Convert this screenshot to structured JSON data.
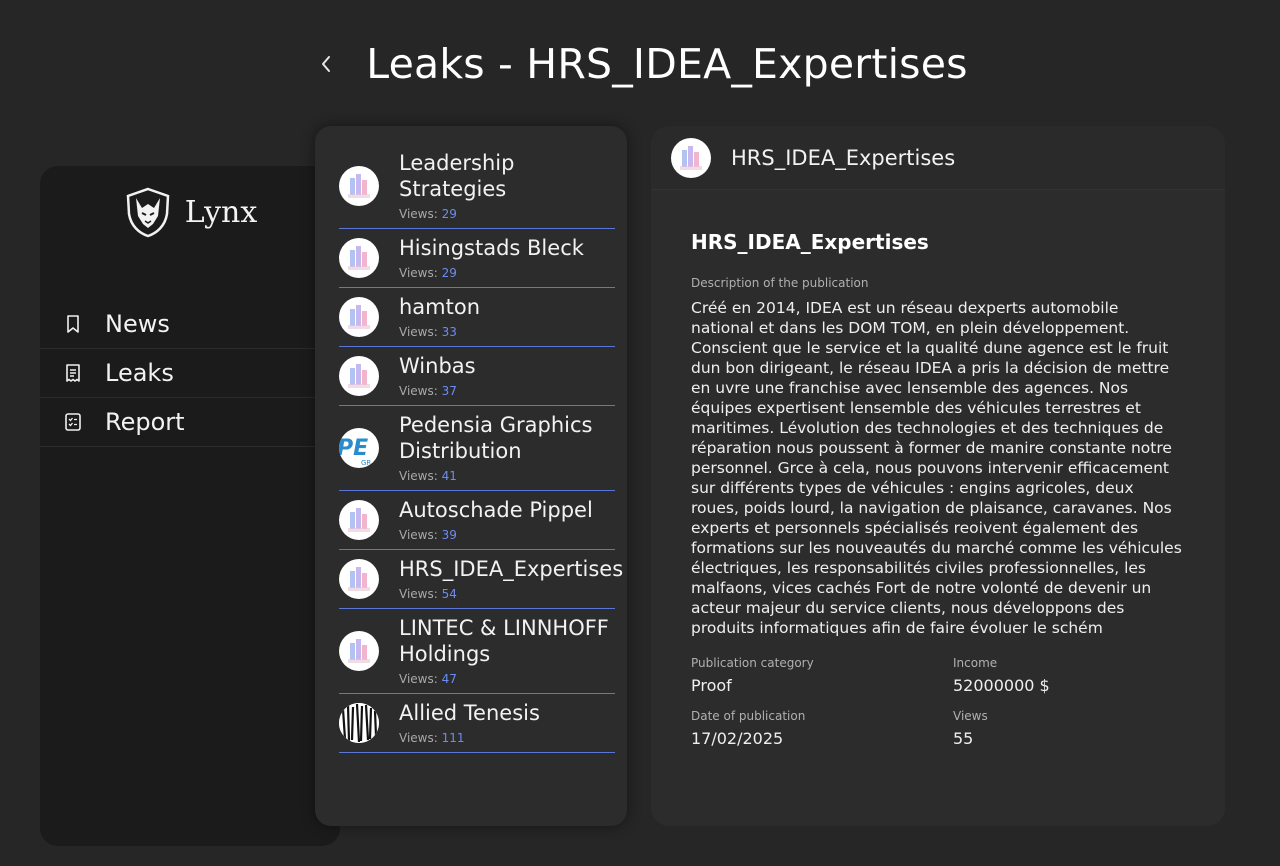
{
  "header": {
    "title": "Leaks - HRS_IDEA_Expertises"
  },
  "sidebar": {
    "brand": "Lynx",
    "nav": [
      {
        "label": "News",
        "icon": "bookmark-icon"
      },
      {
        "label": "Leaks",
        "icon": "receipt-icon"
      },
      {
        "label": "Report",
        "icon": "checklist-icon"
      }
    ]
  },
  "list": {
    "items": [
      {
        "name": "Leadership Strategies",
        "views_label": "Views:",
        "views": "29",
        "logo": "bars"
      },
      {
        "name": "Hisingstads Bleck",
        "views_label": "Views:",
        "views": "29",
        "logo": "bars"
      },
      {
        "name": "hamton",
        "views_label": "Views:",
        "views": "33",
        "logo": "bars"
      },
      {
        "name": "Winbas",
        "views_label": "Views:",
        "views": "37",
        "logo": "bars"
      },
      {
        "name": "Pedensia Graphics Distribution",
        "views_label": "Views:",
        "views": "41",
        "logo": "pg"
      },
      {
        "name": "Autoschade Pippel",
        "views_label": "Views:",
        "views": "39",
        "logo": "bars"
      },
      {
        "name": "HRS_IDEA_Expertises",
        "views_label": "Views:",
        "views": "54",
        "logo": "bars"
      },
      {
        "name": "LINTEC & LINNHOFF Holdings",
        "views_label": "Views:",
        "views": "47",
        "logo": "bars"
      },
      {
        "name": "Allied Tenesis",
        "views_label": "Views:",
        "views": "111",
        "logo": "stripes"
      }
    ]
  },
  "detail": {
    "head_name": "HRS_IDEA_Expertises",
    "title": "HRS_IDEA_Expertises",
    "desc_label": "Description of the publication",
    "description": "Créé en 2014, IDEA est un réseau dexperts automobile national et dans les DOM TOM, en plein développement. Conscient que le service et la qualité dune agence est le fruit dun bon dirigeant, le réseau IDEA a pris la décision de mettre en uvre une franchise avec lensemble des agences. Nos équipes expertisent lensemble des véhicules terrestres et maritimes. Lévolution des technologies et des techniques de réparation nous poussent à former de manire constante notre personnel. Grce à cela, nous pouvons intervenir efficacement sur différents types de véhicules : engins agricoles, deux roues, poids lourd, la navigation de plaisance, caravanes. Nos experts et personnels spécialisés reoivent également des formations sur les nouveautés du marché comme les véhicules électriques, les responsabilités civiles professionnelles, les malfaons, vices cachés Fort de notre volonté de devenir un acteur majeur du service clients, nous développons des produits informatiques afin de faire évoluer le schém",
    "category_label": "Publication category",
    "category": "Proof",
    "income_label": "Income",
    "income": "52000000 $",
    "date_label": "Date of publication",
    "date": "17/02/2025",
    "views_label": "Views",
    "views": "55"
  }
}
